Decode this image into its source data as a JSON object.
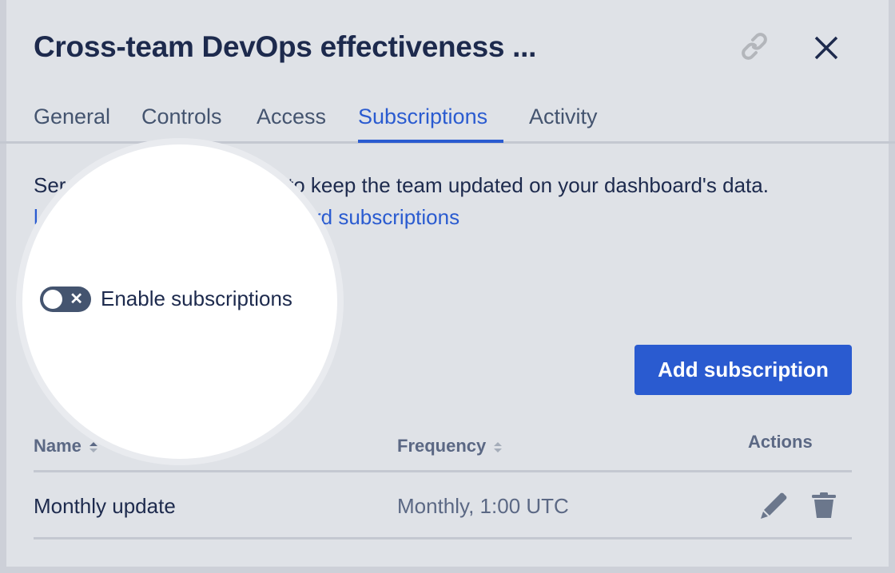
{
  "header": {
    "title": "Cross-team DevOps effectiveness ...",
    "link_icon": "link-icon",
    "close_icon": "close-icon"
  },
  "tabs": [
    {
      "label": "General"
    },
    {
      "label": "Controls"
    },
    {
      "label": "Access"
    },
    {
      "label": "Subscriptions",
      "active": true
    },
    {
      "label": "Activity"
    }
  ],
  "description": {
    "fragment_start": "Ser",
    "fragment_end": "to keep the team updated on your dashboard's data.",
    "link_start": "l",
    "link_end": "rd subscriptions"
  },
  "toggle": {
    "label": "Enable subscriptions",
    "enabled": false
  },
  "add_button": "Add subscription",
  "table": {
    "headers": {
      "name": "Name",
      "frequency": "Frequency",
      "actions": "Actions"
    },
    "rows": [
      {
        "name": "Monthly update",
        "frequency": "Monthly, 1:00 UTC"
      }
    ]
  },
  "colors": {
    "accent": "#2a5bd0",
    "text": "#1d2a4d",
    "muted": "#5b6884",
    "overlay": "#dfe2e7"
  }
}
